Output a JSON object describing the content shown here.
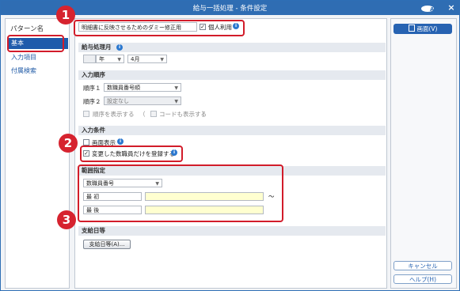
{
  "window": {
    "title": "給与一括処理 - 条件設定",
    "close_label": "×"
  },
  "sidebar": {
    "heading": "パターン名",
    "items": [
      {
        "label": "基本",
        "active": true
      },
      {
        "label": "入力項目",
        "active": false
      },
      {
        "label": "付属検索",
        "active": false
      }
    ]
  },
  "top": {
    "pattern_name": "明細書に反映させるためのダミー修正用",
    "personal_use_label": "個人利用",
    "personal_use_checked": true
  },
  "pay_month": {
    "heading": "給与処理月",
    "year_value": "",
    "year_suffix": "年",
    "month_value": "4月"
  },
  "input_order": {
    "heading": "入力順序",
    "order1_label": "順序１",
    "order1_value": "数職員番号順",
    "order2_label": "順序２",
    "order2_value": "設定なし",
    "show_order_label": "順序を表示する",
    "paren_open": "（",
    "show_code_label": "コードも表示する",
    "paren_close": "）"
  },
  "input_condition": {
    "heading": "入力条件",
    "screen_display_label": "画面表示",
    "changed_only_label": "変更した数職員だけを登録する",
    "changed_only_checked": true
  },
  "range": {
    "heading": "範囲指定",
    "type_value": "数職員番号",
    "first_label": "最 初",
    "last_label": "最 後",
    "tilde": "〜"
  },
  "payday": {
    "heading": "支給日等",
    "button_label": "支給日等(A)..."
  },
  "right_panel": {
    "screen_button": "画面(V)",
    "cancel_button": "キャンセル",
    "help_button": "ヘルプ(H)"
  },
  "badges": [
    "1",
    "2",
    "3"
  ],
  "colors": {
    "accent": "#2f6db3",
    "highlight": "#d21c2a",
    "info": "#2b78cf"
  }
}
